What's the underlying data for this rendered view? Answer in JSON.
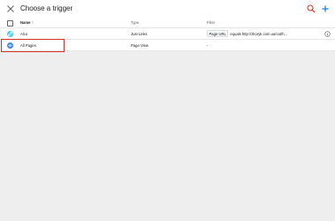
{
  "header": {
    "title": "Choose a trigger",
    "close_icon": "close-icon",
    "search_icon": "search-icon",
    "add_icon": "add-icon"
  },
  "table": {
    "columns": {
      "name": "Name",
      "name_sort": "↑",
      "type": "Type",
      "filter": "Filter"
    },
    "rows": [
      {
        "name": "Alco",
        "type": "Just Links",
        "filter_chip": "Page URL",
        "filter_text": "equals http://zkoryk.com.ua/cat/h...",
        "icon": "link-icon",
        "icon_color": "#4fc3f7",
        "has_info": true
      },
      {
        "name": "All Pages",
        "type": "Page View",
        "filter_text": "-",
        "icon": "eye-icon",
        "icon_color": "#4285f4",
        "has_info": false
      }
    ]
  },
  "colors": {
    "accent": "#1a73e8",
    "highlight": "#d93025"
  }
}
